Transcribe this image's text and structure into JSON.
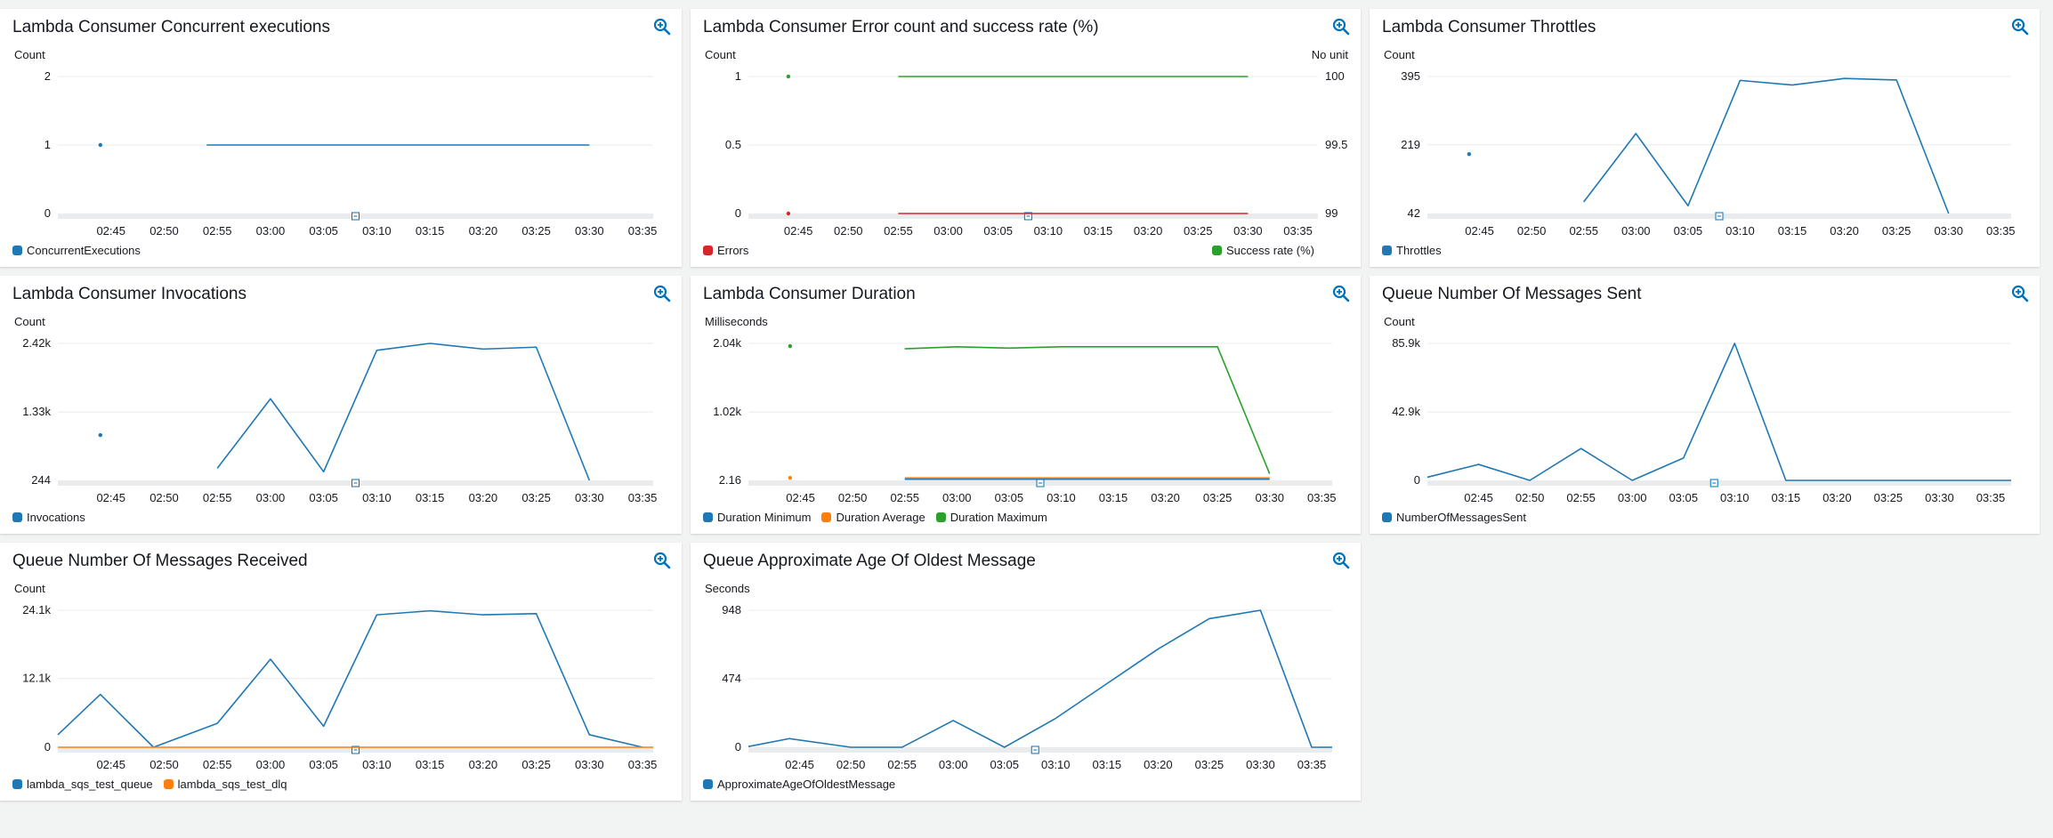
{
  "colors": {
    "blue": "#1f77b4",
    "orange": "#ff7f0e",
    "green": "#2ca02c",
    "red": "#d62728",
    "grid": "#e9ebed",
    "band": "#e9ebed",
    "zoom": "#0073bb"
  },
  "icons": {
    "zoom": "zoom-magnifier-icon",
    "marker": "time-marker-icon"
  },
  "time_ticks": [
    "02:45",
    "02:50",
    "02:55",
    "03:00",
    "03:05",
    "03:10",
    "03:15",
    "03:20",
    "03:25",
    "03:30",
    "03:35"
  ],
  "widgets": [
    {
      "title": "Lambda Consumer Concurrent executions",
      "unit_left": "Count",
      "legend": [
        {
          "label": "ConcurrentExecutions",
          "color": "#1f77b4"
        }
      ]
    },
    {
      "title": "Lambda Consumer Error count and success rate (%)",
      "unit_left": "Count",
      "unit_right": "No unit",
      "legend": [
        {
          "label": "Errors",
          "color": "#d62728"
        },
        {
          "label": "Success rate (%)",
          "color": "#2ca02c"
        }
      ]
    },
    {
      "title": "Lambda Consumer Throttles",
      "unit_left": "Count",
      "legend": [
        {
          "label": "Throttles",
          "color": "#1f77b4"
        }
      ]
    },
    {
      "title": "Lambda Consumer Invocations",
      "unit_left": "Count",
      "legend": [
        {
          "label": "Invocations",
          "color": "#1f77b4"
        }
      ]
    },
    {
      "title": "Lambda Consumer Duration",
      "unit_left": "Milliseconds",
      "legend": [
        {
          "label": "Duration Minimum",
          "color": "#1f77b4"
        },
        {
          "label": "Duration Average",
          "color": "#ff7f0e"
        },
        {
          "label": "Duration Maximum",
          "color": "#2ca02c"
        }
      ]
    },
    {
      "title": "Queue Number Of Messages Sent",
      "unit_left": "Count",
      "legend": [
        {
          "label": "NumberOfMessagesSent",
          "color": "#1f77b4"
        }
      ]
    },
    {
      "title": "Queue Number Of Messages Received",
      "unit_left": "Count",
      "legend": [
        {
          "label": "lambda_sqs_test_queue",
          "color": "#1f77b4"
        },
        {
          "label": "lambda_sqs_test_dlq",
          "color": "#ff7f0e"
        }
      ]
    },
    {
      "title": "Queue Approximate Age Of Oldest Message",
      "unit_left": "Seconds",
      "legend": [
        {
          "label": "ApproximateAgeOfOldestMessage",
          "color": "#1f77b4"
        }
      ]
    }
  ],
  "chart_data": [
    {
      "type": "line",
      "title": "Lambda Consumer Concurrent executions",
      "ylabel": "Count",
      "x_domain": [
        "02:40",
        "03:36"
      ],
      "ylim": [
        0,
        2
      ],
      "yticks": [
        0,
        1,
        2
      ],
      "ytick_labels": [
        "0",
        "1",
        "2"
      ],
      "series": [
        {
          "name": "ConcurrentExecutions",
          "color": "#1f77b4",
          "points": [
            [
              "02:44",
              1
            ],
            null,
            [
              "02:54",
              1
            ],
            [
              "03:30",
              1
            ]
          ]
        }
      ]
    },
    {
      "type": "line",
      "title": "Lambda Consumer Error count and success rate (%)",
      "ylabel": "Count",
      "ylabel_right": "No unit",
      "x_domain": [
        "02:40",
        "03:37"
      ],
      "ylim": [
        0,
        1
      ],
      "yticks": [
        0,
        0.5,
        1
      ],
      "ytick_labels": [
        "0",
        "0.5",
        "1"
      ],
      "ylim_right": [
        99,
        100
      ],
      "yticks_right": [
        99,
        99.5,
        100
      ],
      "ytick_labels_right": [
        "99",
        "99.5",
        "100"
      ],
      "series": [
        {
          "name": "Errors",
          "color": "#d62728",
          "axis": "left",
          "points": [
            [
              "02:44",
              0
            ],
            null,
            [
              "02:55",
              0
            ],
            [
              "03:30",
              0
            ]
          ]
        },
        {
          "name": "Success rate (%)",
          "color": "#2ca02c",
          "axis": "right",
          "points": [
            [
              "02:44",
              100
            ],
            null,
            [
              "02:55",
              100
            ],
            [
              "03:30",
              100
            ]
          ]
        }
      ]
    },
    {
      "type": "line",
      "title": "Lambda Consumer Throttles",
      "ylabel": "Count",
      "x_domain": [
        "02:40",
        "03:36"
      ],
      "ylim": [
        42,
        395
      ],
      "yticks": [
        42,
        219,
        395
      ],
      "ytick_labels": [
        "42",
        "219",
        "395"
      ],
      "series": [
        {
          "name": "Throttles",
          "color": "#1f77b4",
          "points": [
            [
              "02:44",
              195
            ],
            null,
            [
              "02:55",
              72
            ],
            [
              "03:00",
              248
            ],
            [
              "03:05",
              62
            ],
            [
              "03:10",
              385
            ],
            [
              "03:15",
              373
            ],
            [
              "03:20",
              390
            ],
            [
              "03:25",
              386
            ],
            [
              "03:30",
              42
            ]
          ]
        }
      ]
    },
    {
      "type": "line",
      "title": "Lambda Consumer Invocations",
      "ylabel": "Count",
      "x_domain": [
        "02:40",
        "03:36"
      ],
      "ylim": [
        244,
        2420
      ],
      "yticks": [
        244,
        1330,
        2420
      ],
      "ytick_labels": [
        "244",
        "1.33k",
        "2.42k"
      ],
      "series": [
        {
          "name": "Invocations",
          "color": "#1f77b4",
          "points": [
            [
              "02:44",
              963
            ],
            null,
            [
              "02:55",
              437
            ],
            [
              "03:00",
              1540
            ],
            [
              "03:05",
              381
            ],
            [
              "03:10",
              2310
            ],
            [
              "03:15",
              2420
            ],
            [
              "03:20",
              2330
            ],
            [
              "03:25",
              2360
            ],
            [
              "03:30",
              244
            ]
          ]
        }
      ]
    },
    {
      "type": "line",
      "title": "Lambda Consumer Duration",
      "ylabel": "Milliseconds",
      "x_domain": [
        "02:40",
        "03:36"
      ],
      "ylim": [
        2.16,
        2040
      ],
      "yticks": [
        2.16,
        1020,
        2040
      ],
      "ytick_labels": [
        "2.16",
        "1.02k",
        "2.04k"
      ],
      "series": [
        {
          "name": "Duration Minimum",
          "color": "#1f77b4",
          "points": [
            [
              "02:55",
              20
            ],
            [
              "03:30",
              20
            ]
          ]
        },
        {
          "name": "Duration Average",
          "color": "#ff7f0e",
          "points": [
            [
              "02:44",
              40
            ],
            null,
            [
              "02:55",
              40
            ],
            [
              "03:30",
              40
            ]
          ]
        },
        {
          "name": "Duration Maximum",
          "color": "#2ca02c",
          "points": [
            [
              "02:44",
              2000
            ],
            null,
            [
              "02:55",
              1960
            ],
            [
              "03:00",
              1990
            ],
            [
              "03:05",
              1970
            ],
            [
              "03:10",
              1990
            ],
            [
              "03:15",
              1990
            ],
            [
              "03:20",
              1990
            ],
            [
              "03:25",
              1990
            ],
            [
              "03:30",
              100
            ]
          ]
        }
      ]
    },
    {
      "type": "line",
      "title": "Queue Number Of Messages Sent",
      "ylabel": "Count",
      "x_domain": [
        "02:40",
        "03:37"
      ],
      "ylim": [
        0,
        85900
      ],
      "yticks": [
        0,
        42900,
        85900
      ],
      "ytick_labels": [
        "0",
        "42.9k",
        "85.9k"
      ],
      "series": [
        {
          "name": "NumberOfMessagesSent",
          "color": "#1f77b4",
          "points": [
            [
              "02:40",
              2000
            ],
            [
              "02:45",
              10000
            ],
            [
              "02:50",
              0
            ],
            [
              "02:55",
              20000
            ],
            [
              "03:00",
              0
            ],
            [
              "03:05",
              14000
            ],
            [
              "03:10",
              85900
            ],
            [
              "03:15",
              0
            ],
            [
              "03:20",
              0
            ],
            [
              "03:25",
              0
            ],
            [
              "03:30",
              0
            ],
            [
              "03:35",
              0
            ],
            [
              "03:37",
              0
            ]
          ]
        }
      ]
    },
    {
      "type": "line",
      "title": "Queue Number Of Messages Received",
      "ylabel": "Count",
      "x_domain": [
        "02:40",
        "03:36"
      ],
      "ylim": [
        0,
        24100
      ],
      "yticks": [
        0,
        12100,
        24100
      ],
      "ytick_labels": [
        "0",
        "12.1k",
        "24.1k"
      ],
      "series": [
        {
          "name": "lambda_sqs_test_queue",
          "color": "#1f77b4",
          "points": [
            [
              "02:40",
              2200
            ],
            [
              "02:44",
              9300
            ],
            [
              "02:49",
              0
            ],
            [
              "02:55",
              4200
            ],
            [
              "03:00",
              15500
            ],
            [
              "03:05",
              3700
            ],
            [
              "03:10",
              23300
            ],
            [
              "03:15",
              24000
            ],
            [
              "03:20",
              23300
            ],
            [
              "03:25",
              23500
            ],
            [
              "03:30",
              2200
            ],
            [
              "03:35",
              0
            ]
          ]
        },
        {
          "name": "lambda_sqs_test_dlq",
          "color": "#ff7f0e",
          "points": [
            [
              "02:40",
              0
            ],
            [
              "03:36",
              0
            ]
          ]
        }
      ]
    },
    {
      "type": "line",
      "title": "Queue Approximate Age Of Oldest Message",
      "ylabel": "Seconds",
      "x_domain": [
        "02:40",
        "03:37"
      ],
      "ylim": [
        0,
        948
      ],
      "yticks": [
        0,
        474,
        948
      ],
      "ytick_labels": [
        "0",
        "474",
        "948"
      ],
      "series": [
        {
          "name": "ApproximateAgeOfOldestMessage",
          "color": "#1f77b4",
          "points": [
            [
              "02:40",
              5
            ],
            [
              "02:44",
              60
            ],
            [
              "02:50",
              0
            ],
            [
              "02:55",
              0
            ],
            [
              "03:00",
              185
            ],
            [
              "03:05",
              0
            ],
            [
              "03:10",
              200
            ],
            [
              "03:15",
              440
            ],
            [
              "03:20",
              680
            ],
            [
              "03:25",
              890
            ],
            [
              "03:30",
              948
            ],
            [
              "03:35",
              0
            ],
            [
              "03:37",
              0
            ]
          ]
        }
      ]
    }
  ]
}
